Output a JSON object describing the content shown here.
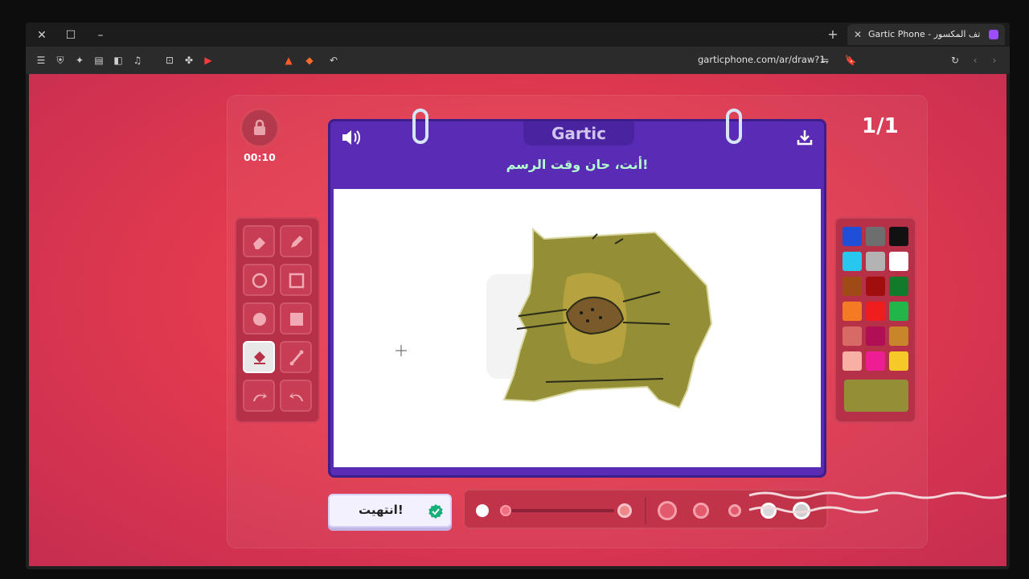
{
  "browser": {
    "tab_title": "Gartic Phone - ية الهاتف المكسور",
    "url": "garticphone.com/ar/draw?1"
  },
  "game": {
    "timer": "00:10",
    "round": "1/1",
    "logo": "Gartic",
    "prompt": "أنت، حان وقت الرسم!",
    "done_button": "انتهيت!"
  },
  "palette": {
    "colors": [
      "#1f4fd6",
      "#6e6e6e",
      "#111111",
      "#27c7f0",
      "#b3b3b3",
      "#ffffff",
      "#a04a16",
      "#a10e0e",
      "#127a2b",
      "#f47b23",
      "#ef1d1d",
      "#21b54a",
      "#d86a65",
      "#b00e55",
      "#c9852a",
      "#f7b0a3",
      "#ef1d93",
      "#f7c928"
    ],
    "selected_color": "#948f36"
  }
}
